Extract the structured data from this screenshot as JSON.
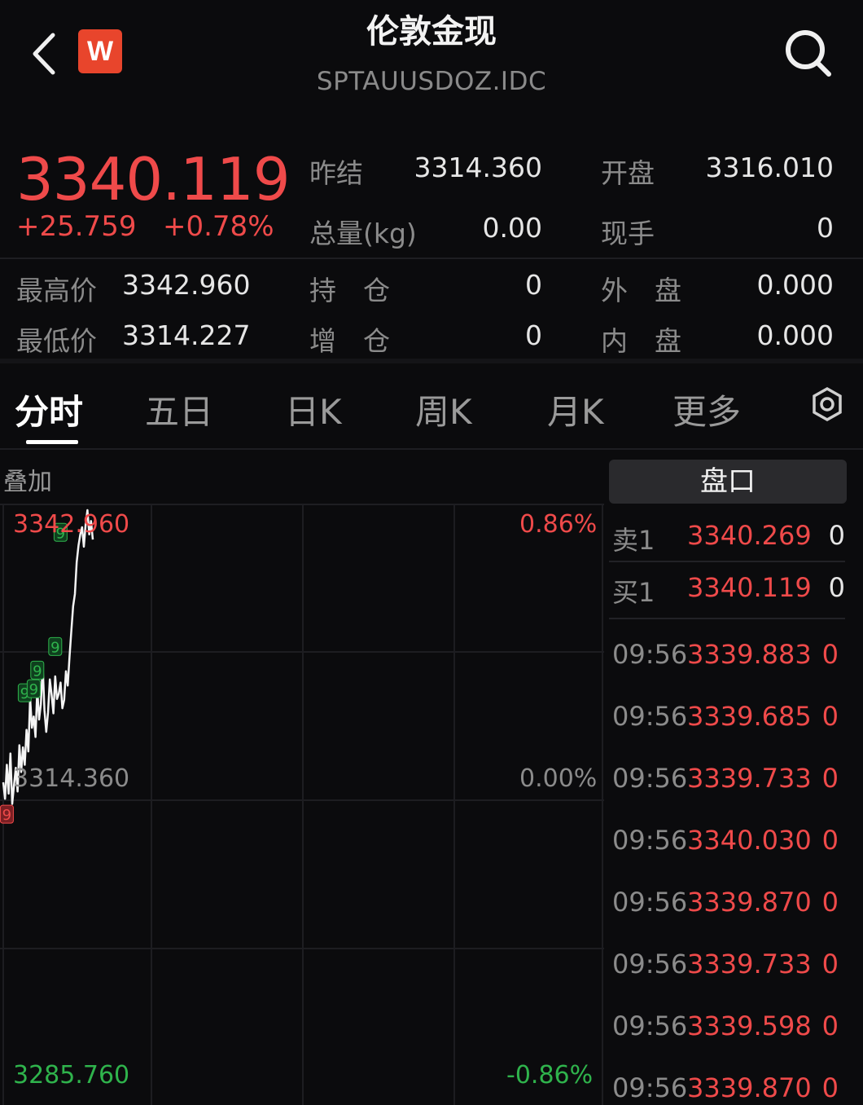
{
  "header": {
    "title": "伦敦金现",
    "symbol": "SPTAUUSDOZ.IDC",
    "logo_letter": "W"
  },
  "quote": {
    "price": "3340.119",
    "change": "+25.759",
    "change_pct": "+0.78%",
    "fields": {
      "prev_settle": {
        "label": "昨结",
        "value": "3314.360"
      },
      "open": {
        "label": "开盘",
        "value": "3316.010"
      },
      "volume": {
        "label": "总量(kg)",
        "value": "0.00"
      },
      "current_hand": {
        "label": "现手",
        "value": "0"
      },
      "high": {
        "label": "最高价",
        "value": "3342.960"
      },
      "open_interest": {
        "label": "持　仓",
        "value": "0"
      },
      "outer": {
        "label": "外　盘",
        "value": "0.000"
      },
      "low": {
        "label": "最低价",
        "value": "3314.227"
      },
      "oi_change": {
        "label": "增　仓",
        "value": "0"
      },
      "inner": {
        "label": "内　盘",
        "value": "0.000"
      }
    }
  },
  "tabs": [
    {
      "label": "分时",
      "active": true
    },
    {
      "label": "五日"
    },
    {
      "label": "日K"
    },
    {
      "label": "周K"
    },
    {
      "label": "月K"
    },
    {
      "label": "更多"
    }
  ],
  "chart_panel": {
    "overlay_label": "叠加",
    "top_price": "3342.960",
    "mid_price": "3314.360",
    "bottom_price": "3285.760",
    "top_pct": "0.86%",
    "mid_pct": "0.00%",
    "bottom_pct": "-0.86%",
    "marker_digit": "9"
  },
  "chart_data": {
    "type": "line",
    "ylim": [
      3285.76,
      3342.96
    ],
    "reference": 3314.36,
    "x": [
      0,
      1,
      2,
      3,
      4,
      5,
      6,
      7,
      8,
      9,
      10,
      11,
      12,
      13,
      14,
      15,
      16,
      17,
      18,
      19,
      20,
      21,
      22,
      23,
      24,
      25,
      26,
      27,
      28,
      29,
      30,
      31,
      32,
      33,
      34,
      35,
      36,
      37,
      38,
      39,
      40,
      41,
      42,
      43,
      44,
      45,
      46,
      47,
      48,
      49,
      50
    ],
    "values": [
      3316.5,
      3314.9,
      3318.2,
      3315.4,
      3319.3,
      3314.4,
      3316.2,
      3317.9,
      3315.6,
      3320.1,
      3317.5,
      3319.9,
      3318.2,
      3321.6,
      3319.5,
      3324.7,
      3321.8,
      3322.9,
      3320.9,
      3325.6,
      3322.6,
      3324.1,
      3327.9,
      3323.5,
      3321.4,
      3323.3,
      3326.5,
      3325.0,
      3323.2,
      3326.8,
      3324.6,
      3325.1,
      3326.2,
      3323.7,
      3324.5,
      3327.3,
      3325.9,
      3328.7,
      3331.2,
      3333.6,
      3334.8,
      3337.9,
      3339.5,
      3340.6,
      3341.3,
      3339.4,
      3341.6,
      3342.96,
      3340.6,
      3341.9,
      3340.1
    ],
    "max_x": 380,
    "markers": [
      {
        "x": 2,
        "value": 3313.4,
        "color": "#ef4a4a"
      },
      {
        "x": 12,
        "value": 3325.2,
        "color": "#2fb34c"
      },
      {
        "x": 17,
        "value": 3325.6,
        "color": "#2fb34c"
      },
      {
        "x": 19,
        "value": 3327.4,
        "color": "#2fb34c"
      },
      {
        "x": 29,
        "value": 3329.7,
        "color": "#2fb34c"
      },
      {
        "x": 32,
        "value": 3340.8,
        "color": "#2fb34c"
      }
    ]
  },
  "order_book": {
    "button_label": "盘口",
    "asks": [
      {
        "label": "卖1",
        "price": "3340.269",
        "qty": "0"
      }
    ],
    "bids": [
      {
        "label": "买1",
        "price": "3340.119",
        "qty": "0"
      }
    ],
    "ticks": [
      {
        "time": "09:56",
        "price": "3339.883",
        "qty": "0"
      },
      {
        "time": "09:56",
        "price": "3339.685",
        "qty": "0"
      },
      {
        "time": "09:56",
        "price": "3339.733",
        "qty": "0"
      },
      {
        "time": "09:56",
        "price": "3340.030",
        "qty": "0"
      },
      {
        "time": "09:56",
        "price": "3339.870",
        "qty": "0"
      },
      {
        "time": "09:56",
        "price": "3339.733",
        "qty": "0"
      },
      {
        "time": "09:56",
        "price": "3339.598",
        "qty": "0"
      },
      {
        "time": "09:56",
        "price": "3339.870",
        "qty": "0"
      }
    ]
  },
  "colors": {
    "up": "#ef4a4a",
    "down": "#2fb34c",
    "background": "#0b0b0d",
    "brand": "#e8452c"
  },
  "icons": {
    "back": "chevron-left-icon",
    "search": "search-icon",
    "settings": "gear-icon"
  }
}
